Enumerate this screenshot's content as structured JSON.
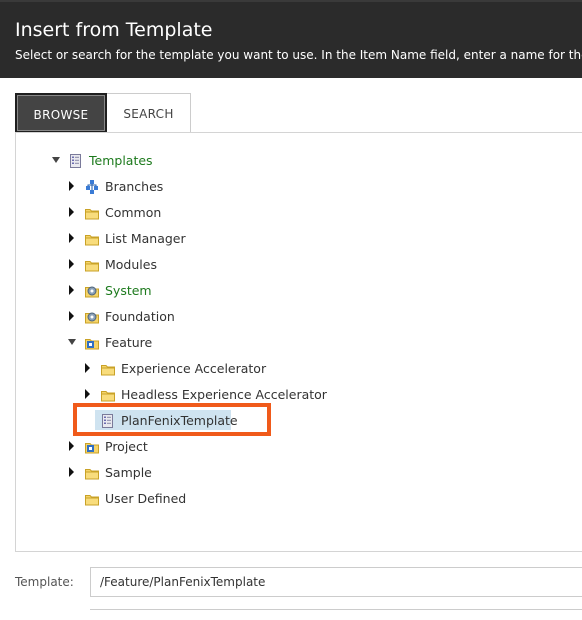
{
  "dialog": {
    "title": "Insert from Template",
    "description": "Select or search for the template you want to use. In the Item Name field, enter a name for the new ite"
  },
  "tabs": {
    "browse": "BROWSE",
    "search": "SEARCH",
    "active": "BROWSE"
  },
  "tree": {
    "root": "Templates",
    "branches": "Branches",
    "common": "Common",
    "list_manager": "List Manager",
    "modules": "Modules",
    "system": "System",
    "foundation": "Foundation",
    "feature": "Feature",
    "experience_accelerator": "Experience Accelerator",
    "headless_experience_accelerator": "Headless Experience Accelerator",
    "planfenix_template": "PlanFenixTemplate",
    "project": "Project",
    "sample": "Sample",
    "user_defined": "User Defined",
    "selected": "PlanFenixTemplate"
  },
  "form": {
    "template_label": "Template:",
    "template_value": "/Feature/PlanFenixTemplate"
  },
  "colors": {
    "header_bg": "#2b2b2b",
    "highlight": "#f05a1a",
    "selection": "#cfe3f0",
    "green_text": "#1d7a1d",
    "folder": "#f2c94c"
  },
  "icons": {
    "template": "template-icon",
    "branches": "branches-icon",
    "folder": "folder-icon",
    "system": "system-folder-icon",
    "feature": "feature-folder-icon"
  }
}
